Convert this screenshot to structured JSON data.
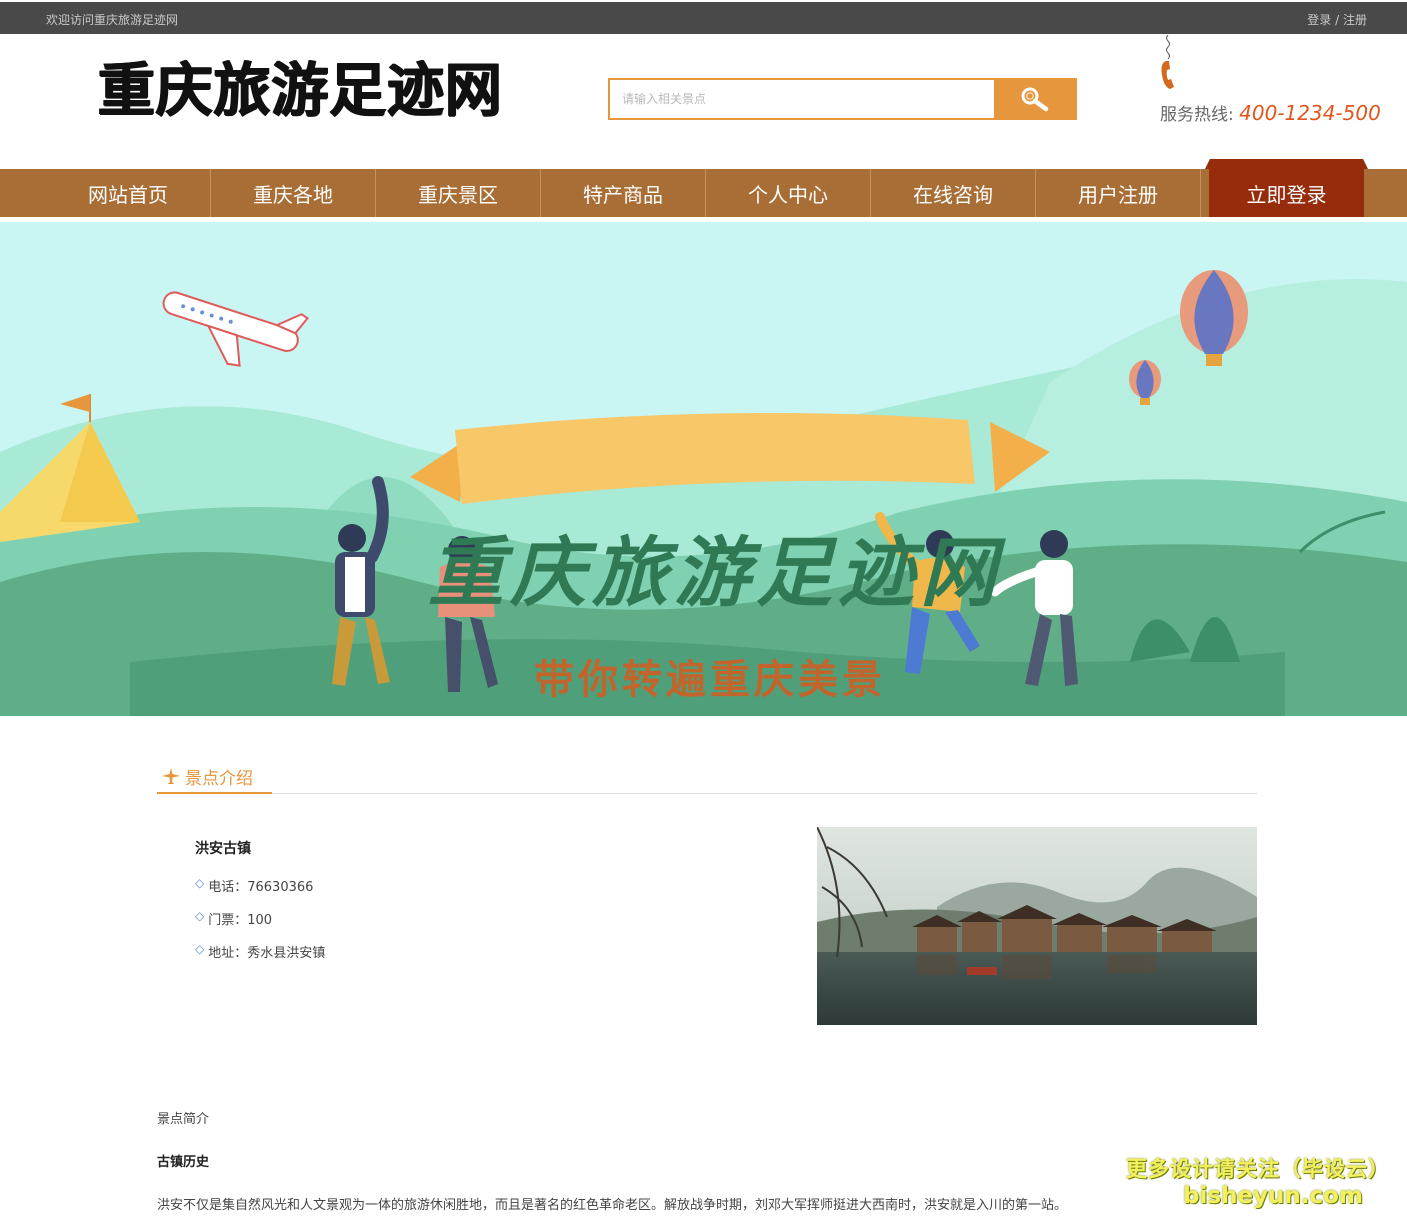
{
  "topbar": {
    "welcome": "欢迎访问重庆旅游足迹网",
    "login": "登录",
    "separator": " / ",
    "register": "注册"
  },
  "header": {
    "logo_text": "重庆旅游足迹网",
    "search_placeholder": "请输入相关景点",
    "hotline_label": "服务热线:",
    "hotline_number": "400-1234-500"
  },
  "nav": {
    "items": [
      {
        "label": "网站首页"
      },
      {
        "label": "重庆各地"
      },
      {
        "label": "重庆景区"
      },
      {
        "label": "特产商品"
      },
      {
        "label": "个人中心"
      },
      {
        "label": "在线咨询"
      },
      {
        "label": "用户注册"
      },
      {
        "label": "立即登录"
      }
    ]
  },
  "banner": {
    "title": "重庆旅游足迹网",
    "subtitle": "带你转遍重庆美景"
  },
  "section": {
    "title": "景点介绍"
  },
  "spot": {
    "name": "洪安古镇",
    "phone": "电话：76630366",
    "ticket": "门票：100",
    "address": "地址：秀水县洪安镇"
  },
  "intro": {
    "label": "景点简介",
    "heading": "古镇历史",
    "paragraph": "洪安不仅是集自然风光和人文景观为一体的旅游休闲胜地，而且是著名的红色革命老区。解放战争时期，刘邓大军挥师挺进大西南时，洪安就是入川的第一站。"
  },
  "watermark": {
    "line1": "更多设计请关注（毕设云）",
    "line2": "bisheyun.com"
  },
  "colors": {
    "accent": "#e6963c",
    "nav_bg": "#a86e36",
    "nav_active": "#962c0c",
    "topbar_bg": "#494949",
    "hotline": "#e0561e"
  }
}
